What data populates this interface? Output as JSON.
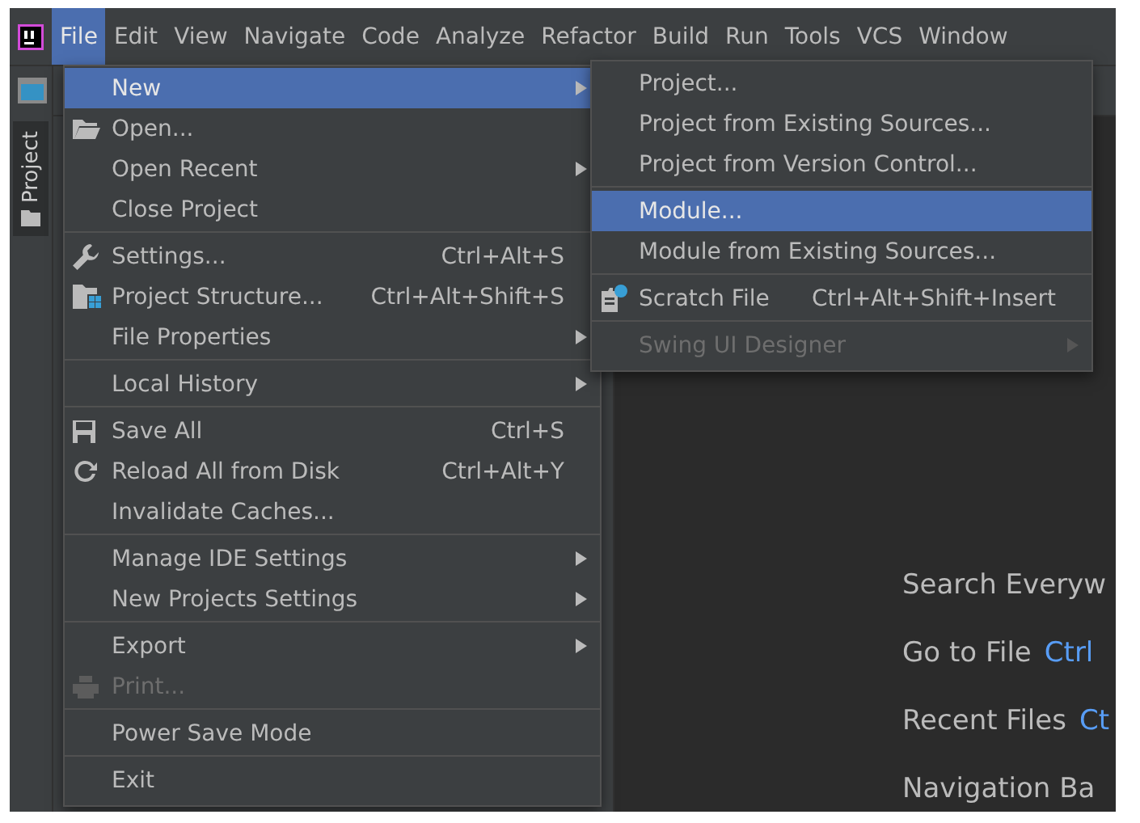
{
  "menubar": {
    "items": [
      {
        "label": "File",
        "selected": true
      },
      {
        "label": "Edit",
        "selected": false
      },
      {
        "label": "View",
        "selected": false
      },
      {
        "label": "Navigate",
        "selected": false
      },
      {
        "label": "Code",
        "selected": false
      },
      {
        "label": "Analyze",
        "selected": false
      },
      {
        "label": "Refactor",
        "selected": false
      },
      {
        "label": "Build",
        "selected": false
      },
      {
        "label": "Run",
        "selected": false
      },
      {
        "label": "Tools",
        "selected": false
      },
      {
        "label": "VCS",
        "selected": false
      },
      {
        "label": "Window",
        "selected": false
      }
    ]
  },
  "sidebar": {
    "tab": {
      "label": "Project"
    }
  },
  "file_menu": {
    "sections": [
      [
        {
          "kind": "plain",
          "label": "New",
          "submenu": true,
          "disabled": false,
          "selected": true
        },
        {
          "kind": "folder",
          "label": "Open...",
          "submenu": false,
          "disabled": false,
          "selected": false
        },
        {
          "kind": "plain",
          "label": "Open Recent",
          "submenu": true,
          "disabled": false,
          "selected": false
        },
        {
          "kind": "plain",
          "label": "Close Project",
          "submenu": false,
          "disabled": false,
          "selected": false
        }
      ],
      [
        {
          "kind": "wrench",
          "label": "Settings...",
          "shortcut": "Ctrl+Alt+S",
          "submenu": false,
          "disabled": false,
          "selected": false
        },
        {
          "kind": "structure",
          "label": "Project Structure...",
          "shortcut": "Ctrl+Alt+Shift+S",
          "submenu": false,
          "disabled": false,
          "selected": false
        },
        {
          "kind": "plain",
          "label": "File Properties",
          "submenu": true,
          "disabled": false,
          "selected": false
        }
      ],
      [
        {
          "kind": "plain",
          "label": "Local History",
          "submenu": true,
          "disabled": false,
          "selected": false
        }
      ],
      [
        {
          "kind": "save",
          "label": "Save All",
          "shortcut": "Ctrl+S",
          "submenu": false,
          "disabled": false,
          "selected": false
        },
        {
          "kind": "reload",
          "label": "Reload All from Disk",
          "shortcut": "Ctrl+Alt+Y",
          "submenu": false,
          "disabled": false,
          "selected": false
        },
        {
          "kind": "plain",
          "label": "Invalidate Caches...",
          "submenu": false,
          "disabled": false,
          "selected": false
        }
      ],
      [
        {
          "kind": "plain",
          "label": "Manage IDE Settings",
          "submenu": true,
          "disabled": false,
          "selected": false
        },
        {
          "kind": "plain",
          "label": "New Projects Settings",
          "submenu": true,
          "disabled": false,
          "selected": false
        }
      ],
      [
        {
          "kind": "plain",
          "label": "Export",
          "submenu": true,
          "disabled": false,
          "selected": false
        },
        {
          "kind": "print",
          "label": "Print...",
          "submenu": false,
          "disabled": true,
          "selected": false
        }
      ],
      [
        {
          "kind": "plain",
          "label": "Power Save Mode",
          "submenu": false,
          "disabled": false,
          "selected": false
        }
      ],
      [
        {
          "kind": "plain",
          "label": "Exit",
          "submenu": false,
          "disabled": false,
          "selected": false
        }
      ]
    ]
  },
  "new_submenu": {
    "sections": [
      [
        {
          "kind": "plain",
          "label": "Project...",
          "submenu": false,
          "disabled": false,
          "selected": false
        },
        {
          "kind": "plain",
          "label": "Project from Existing Sources...",
          "submenu": false,
          "disabled": false,
          "selected": false
        },
        {
          "kind": "plain",
          "label": "Project from Version Control...",
          "submenu": false,
          "disabled": false,
          "selected": false
        }
      ],
      [
        {
          "kind": "plain",
          "label": "Module...",
          "submenu": false,
          "disabled": false,
          "selected": true
        },
        {
          "kind": "plain",
          "label": "Module from Existing Sources...",
          "submenu": false,
          "disabled": false,
          "selected": false
        }
      ],
      [
        {
          "kind": "scratch",
          "label": "Scratch File",
          "shortcut": "Ctrl+Alt+Shift+Insert",
          "submenu": false,
          "disabled": false,
          "selected": false
        }
      ],
      [
        {
          "kind": "plain",
          "label": "Swing UI Designer",
          "submenu": true,
          "disabled": true,
          "selected": false
        }
      ]
    ]
  },
  "editor_hints": [
    {
      "label": "Search Everyw"
    },
    {
      "label": "Go to File",
      "shortcut": "Ctrl"
    },
    {
      "label": "Recent Files",
      "shortcut": "Ct"
    },
    {
      "label": "Navigation Ba"
    }
  ]
}
